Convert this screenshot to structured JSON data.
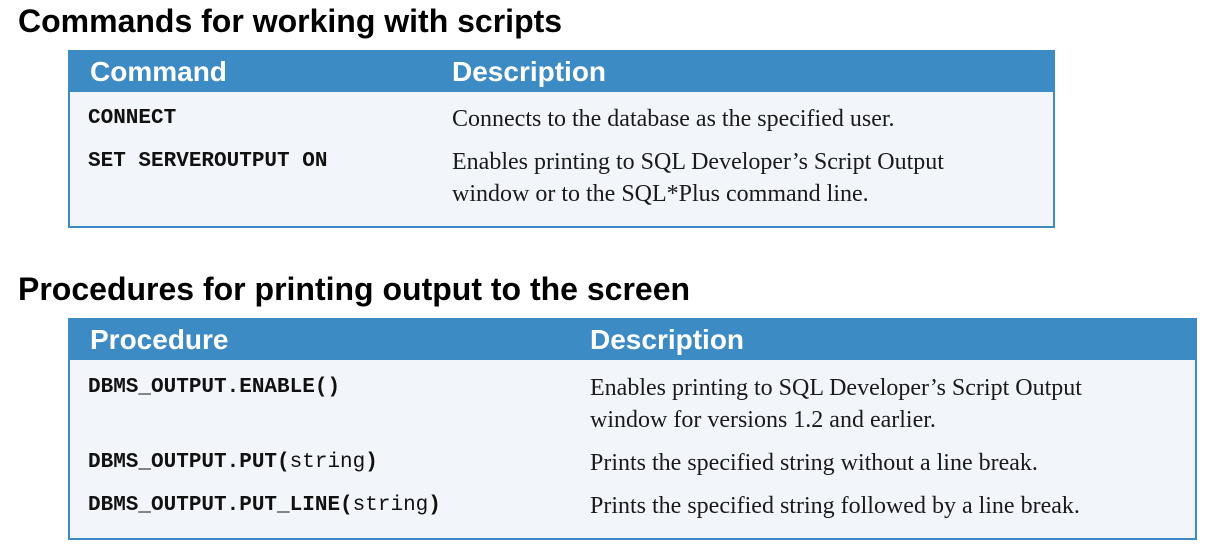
{
  "section1": {
    "title": "Commands for working with scripts",
    "col_command": "Command",
    "col_description": "Description",
    "rows": [
      {
        "command": "CONNECT",
        "description_lines": [
          "Connects to the database as the specified user."
        ]
      },
      {
        "command": "SET SERVEROUTPUT ON",
        "description_lines": [
          "Enables printing to SQL Developer’s Script Output",
          "window or to the SQL*Plus command line."
        ]
      }
    ]
  },
  "section2": {
    "title": "Procedures for printing output to the screen",
    "col_procedure": "Procedure",
    "col_description": "Description",
    "rows": [
      {
        "procedure": "DBMS_OUTPUT.ENABLE()",
        "arg": "",
        "close": "",
        "description_lines": [
          "Enables printing to SQL Developer’s Script Output",
          "window for versions 1.2 and earlier."
        ]
      },
      {
        "procedure": "DBMS_OUTPUT.PUT(",
        "arg": "string",
        "close": ")",
        "description_lines": [
          "Prints the specified string without a line break."
        ]
      },
      {
        "procedure": "DBMS_OUTPUT.PUT_LINE(",
        "arg": "string",
        "close": ")",
        "description_lines": [
          "Prints the specified string followed by a line break."
        ]
      }
    ]
  },
  "colors": {
    "header_bg": "#3d8bc4",
    "table_bg": "#f2f6fa",
    "header_text": "#ffffff"
  }
}
